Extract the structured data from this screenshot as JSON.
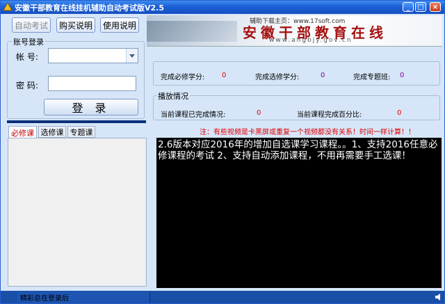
{
  "window": {
    "title": "安徽干部教育在线挂机辅助自动考试版V2.5"
  },
  "toolbar": {
    "auto_exam": "自动考试",
    "buy_help": "购买说明",
    "usage_help": "使用说明"
  },
  "banner": {
    "site_text": "辅助下载主页：www.17soft.com",
    "logo_text": "安徽干部教育在线",
    "url": "www.ahgbjy.gov.cn"
  },
  "login": {
    "group_title": "账号登录",
    "account_label": "帐  号:",
    "account_value": "",
    "password_label": "密  码:",
    "password_value": "",
    "login_button": "登 录"
  },
  "credits": {
    "required_label": "完成必修学分:",
    "required_value": "0",
    "elective_label": "完成选修学分:",
    "elective_value": "0",
    "topic_label": "完成专题班:",
    "topic_value": "0"
  },
  "playback": {
    "group_title": "播放情况",
    "current_done_label": "当前课程已完成情况:",
    "current_done_value": "0",
    "current_percent_label": "当前课程完成百分比:",
    "current_percent_value": "0"
  },
  "notice": "注：有些视频是卡黑屏或重复一个视频都没有关系！时间一样计算！！",
  "tabs": [
    {
      "label": "必修课"
    },
    {
      "label": "选修课"
    },
    {
      "label": "专题课"
    }
  ],
  "console_text": "2.6版本对应2016年的增加自选课学习课程。。1、支持2016任意必修课程的考试 2、支持自动添加课程，不用再需要手工选课！",
  "status": {
    "text": "精彩总在登录后"
  },
  "colors": {
    "title_bar": "#1b5fd6",
    "value_red": "#e00000",
    "console_bg": "#000000"
  }
}
